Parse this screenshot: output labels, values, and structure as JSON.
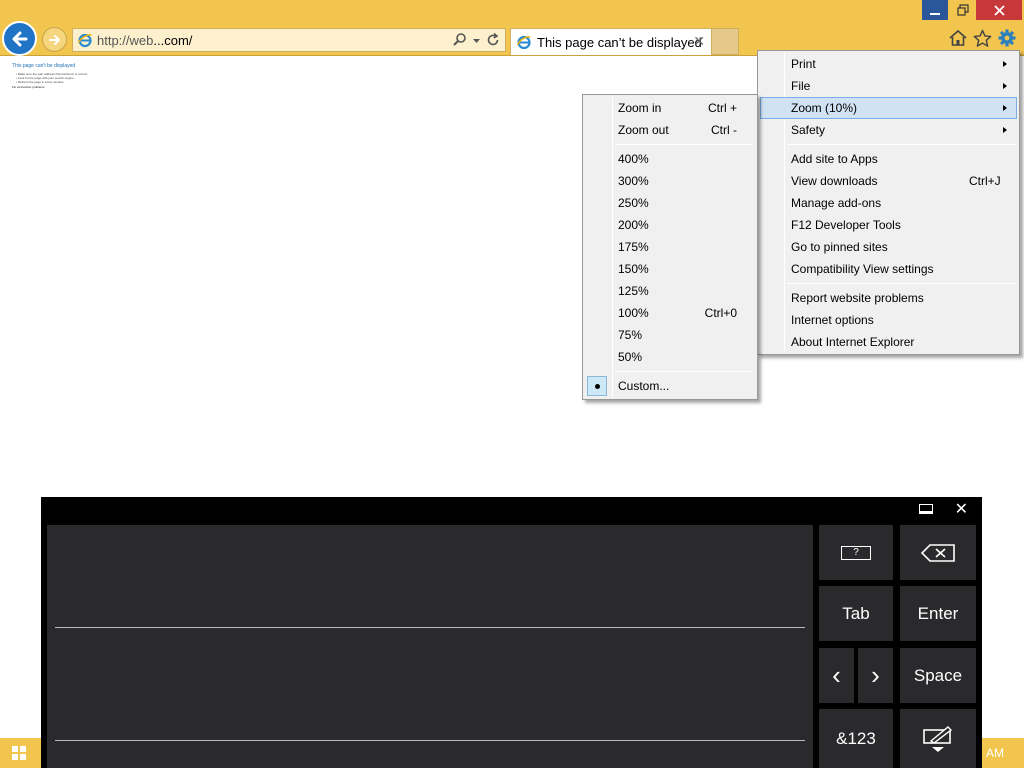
{
  "browser": {
    "address_url_prefix": "http://web",
    "address_url_domain": "...com/",
    "tab_title": "This page can’t be displayed",
    "tab_close": "✕"
  },
  "page_content": {
    "title": "This page can't be displayed",
    "lines": [
      "• Make sure the web address http://webcom is correct.",
      "• Look for the page with your search engine.",
      "• Refresh the page in a few minutes."
    ],
    "footer": "Fix connection problems"
  },
  "tools_menu": {
    "items": [
      {
        "label": "Print",
        "shortcut": ""
      },
      {
        "label": "File",
        "shortcut": ""
      },
      {
        "label": "Zoom (10%)",
        "shortcut": ""
      },
      {
        "label": "Safety",
        "shortcut": ""
      },
      {
        "label": "Add site to Apps",
        "shortcut": ""
      },
      {
        "label": "View downloads",
        "shortcut": "Ctrl+J"
      },
      {
        "label": "Manage add-ons",
        "shortcut": ""
      },
      {
        "label": "F12 Developer Tools",
        "shortcut": ""
      },
      {
        "label": "Go to pinned sites",
        "shortcut": ""
      },
      {
        "label": "Compatibility View settings",
        "shortcut": ""
      },
      {
        "label": "Report website problems",
        "shortcut": ""
      },
      {
        "label": "Internet options",
        "shortcut": ""
      },
      {
        "label": "About Internet Explorer",
        "shortcut": ""
      }
    ],
    "highlighted": "Zoom (10%)"
  },
  "zoom_menu": {
    "items": [
      {
        "label": "Zoom in",
        "shortcut": "Ctrl +"
      },
      {
        "label": "Zoom out",
        "shortcut": "Ctrl -"
      },
      {
        "label": "400%",
        "shortcut": ""
      },
      {
        "label": "300%",
        "shortcut": ""
      },
      {
        "label": "250%",
        "shortcut": ""
      },
      {
        "label": "200%",
        "shortcut": ""
      },
      {
        "label": "175%",
        "shortcut": ""
      },
      {
        "label": "150%",
        "shortcut": ""
      },
      {
        "label": "125%",
        "shortcut": ""
      },
      {
        "label": "100%",
        "shortcut": "Ctrl+0"
      },
      {
        "label": "75%",
        "shortcut": ""
      },
      {
        "label": "50%",
        "shortcut": ""
      },
      {
        "label": "Custom...",
        "shortcut": ""
      }
    ],
    "checked": "Custom..."
  },
  "keyboard": {
    "close": "✕",
    "keys": {
      "help": "?",
      "tab": "Tab",
      "enter": "Enter",
      "left": "‹",
      "right": "›",
      "space": "Space",
      "symbols": "&123"
    }
  },
  "taskbar": {
    "clock": "AM"
  },
  "colors": {
    "frame": "#f2c64e",
    "accent_blue": "#1f74c6",
    "close_red": "#c7383b",
    "menu_bg": "#f0f0f0",
    "menu_highlight": "#d1e2f2",
    "keyboard_key": "#2a2a2d"
  },
  "icons": [
    "back-arrow-icon",
    "forward-arrow-icon",
    "ie-logo-icon",
    "search-icon",
    "dropdown-icon",
    "refresh-icon",
    "home-icon",
    "favorites-star-icon",
    "tools-gear-icon",
    "minimize-icon",
    "restore-icon",
    "close-icon",
    "backspace-icon",
    "dock-icon",
    "handwriting-pen-icon",
    "windows-logo-icon"
  ]
}
